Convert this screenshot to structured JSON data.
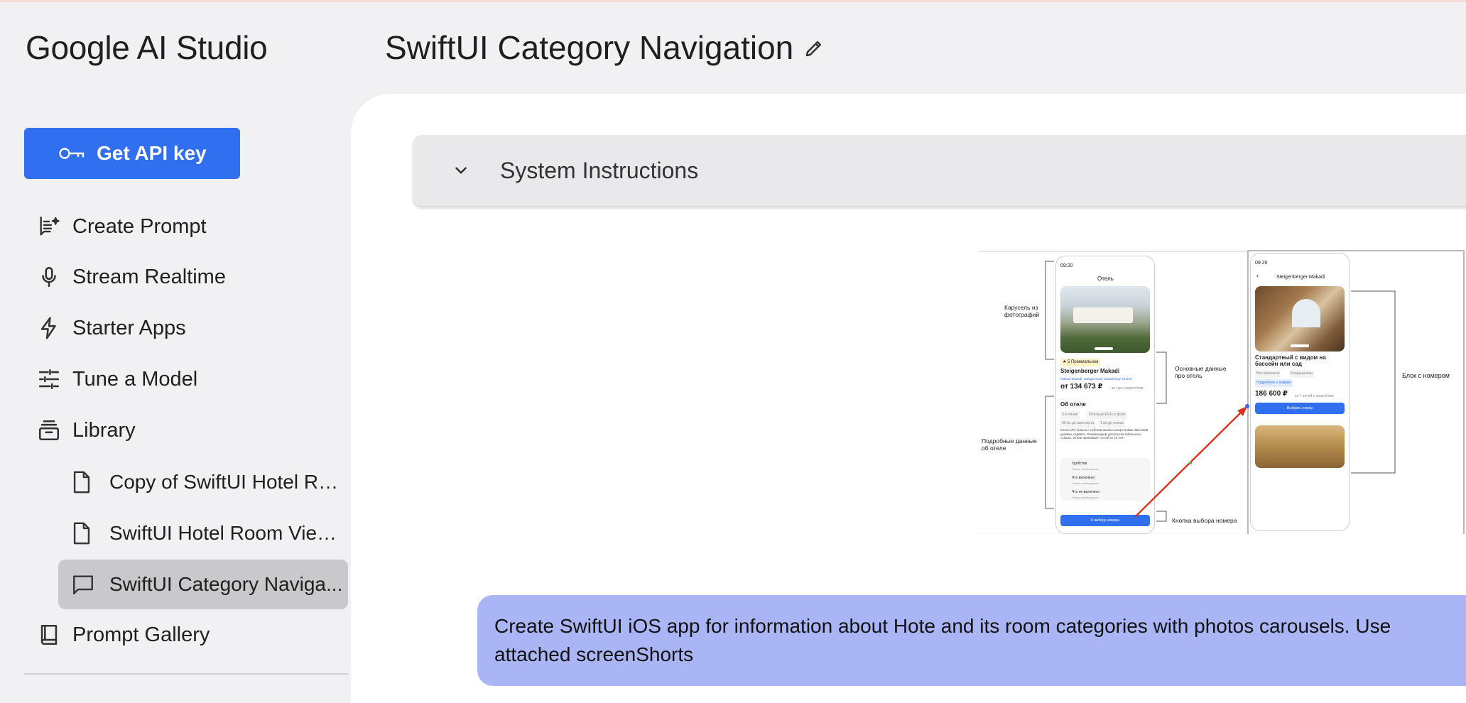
{
  "header": {
    "app_title": "Google AI Studio",
    "page_title": "SwiftUI Category Navigation",
    "edit_icon": "pencil-icon"
  },
  "sidebar": {
    "api_key_label": "Get API key",
    "api_key_icon": "key-icon",
    "items": [
      {
        "label": "Create Prompt",
        "icon": "create-prompt-icon"
      },
      {
        "label": "Stream Realtime",
        "icon": "microphone-icon"
      },
      {
        "label": "Starter Apps",
        "icon": "bolt-icon"
      },
      {
        "label": "Tune a Model",
        "icon": "tune-icon"
      },
      {
        "label": "Library",
        "icon": "library-icon"
      }
    ],
    "library_items": [
      {
        "label": "Copy of SwiftUI Hotel Ro...",
        "icon": "document-icon"
      },
      {
        "label": "SwiftUI Hotel Room View ...",
        "icon": "document-icon"
      },
      {
        "label": "SwiftUI Category Naviga...",
        "icon": "chat-icon",
        "active": true
      }
    ],
    "gallery": {
      "label": "Prompt Gallery",
      "icon": "book-icon"
    }
  },
  "main": {
    "system_instructions_label": "System Instructions",
    "attachment": {
      "phone1": {
        "time": "09:20",
        "title": "Отель",
        "badge": "★ 5 Премиальное",
        "hotel_name": "Steigenberger Makadi",
        "address": "Makadi Makadi, Safaga Road, Makadi Bay, Египет",
        "price": "от 134 673 ₽",
        "price_note": "за тур с перелётом",
        "about": "Об отеле",
        "tags": [
          "3-я линия",
          "Платный Wi-Fi в фойе",
          "30 км до аэропорта",
          "1 км до пляжа"
        ],
        "description": "Отель VIP-класса с собственными гольф полями. Высокий уровень сервиса. Рекомендуем для респектабельного отдыха. Отель принимает гостей от 18 лет!",
        "rows": [
          {
            "title": "Удобства",
            "sub": "Самое необходимое"
          },
          {
            "title": "Что включено",
            "sub": "Самое необходимое"
          },
          {
            "title": "Что не включено",
            "sub": "Самое необходимое"
          }
        ],
        "button": "К выбору номера"
      },
      "phone2": {
        "time": "09:20",
        "title": "Steigenberger Makadi",
        "room_title": "Стандартный с видом на бассейн или сад",
        "tags": [
          "Все включено",
          "Кондиционер"
        ],
        "details_link": "Подробнее о номере",
        "price": "186 600 ₽",
        "price_note": "за 7 ночей с перелётом",
        "button": "Выбрать номер"
      },
      "annotations": {
        "carousel": "Карусель из фотографий",
        "main_data": "Основные данные про отель",
        "detailed_data": "Подробные данные об отеле",
        "room_button": "Кнопка выбора номера",
        "room_block": "Блок с номером"
      }
    },
    "prompt_text": "Create SwiftUI iOS app for information about Hote and its room categories with photos carousels. Use attached screenShorts"
  },
  "colors": {
    "accent": "#2f6ff0",
    "prompt_bubble": "#aab5f5",
    "active_item": "#c9c9cb"
  }
}
